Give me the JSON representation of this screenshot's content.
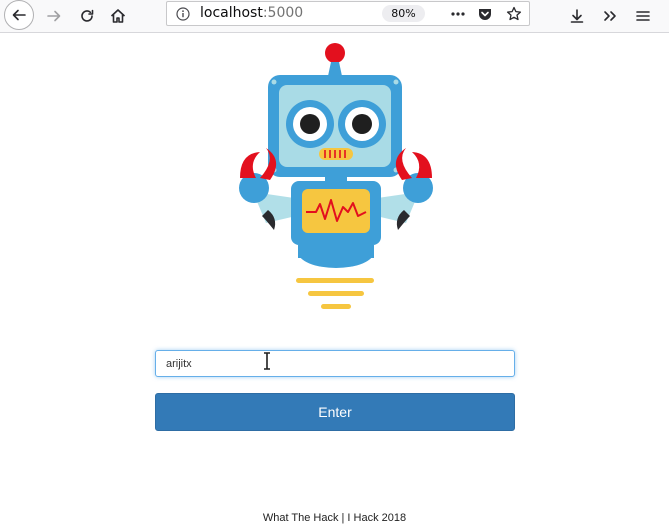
{
  "browser": {
    "url_host": "localhost",
    "url_port": ":5000",
    "zoom": "80%",
    "icons": [
      "back-arrow-icon",
      "forward-arrow-icon",
      "reload-icon",
      "home-icon",
      "info-icon",
      "more-dots-icon",
      "pocket-icon",
      "bookmark-star-icon",
      "download-icon",
      "overflow-chevrons-icon",
      "hamburger-menu-icon"
    ]
  },
  "form": {
    "input_value": "arijitx",
    "button_label": "Enter"
  },
  "footer": {
    "text": "What The Hack | I Hack 2018"
  },
  "colors": {
    "button_bg": "#337ab7",
    "robot_blue": "#3e9fd8",
    "robot_face": "#a9dbe6",
    "robot_red": "#e3101e",
    "robot_yellow": "#f6c640"
  }
}
